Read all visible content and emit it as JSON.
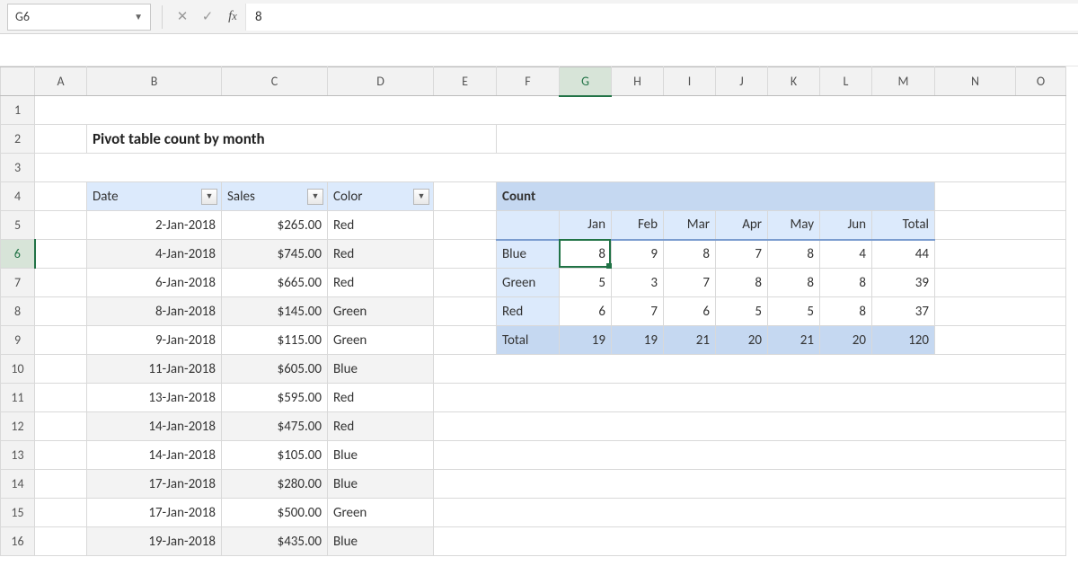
{
  "formula_bar": {
    "cell_ref": "G6",
    "value": "8"
  },
  "title": "Pivot table count by month",
  "columns": [
    "A",
    "B",
    "C",
    "D",
    "E",
    "F",
    "G",
    "H",
    "I",
    "J",
    "K",
    "L",
    "M",
    "N",
    "O"
  ],
  "rows": [
    "1",
    "2",
    "3",
    "4",
    "5",
    "6",
    "7",
    "8",
    "9",
    "10",
    "11",
    "12",
    "13",
    "14",
    "15",
    "16"
  ],
  "active_col": "G",
  "active_row": "6",
  "source": {
    "headers": {
      "date": "Date",
      "sales": "Sales",
      "color": "Color"
    },
    "rows": [
      {
        "date": "2-Jan-2018",
        "sales": "$265.00",
        "color": "Red"
      },
      {
        "date": "4-Jan-2018",
        "sales": "$745.00",
        "color": "Red"
      },
      {
        "date": "6-Jan-2018",
        "sales": "$665.00",
        "color": "Red"
      },
      {
        "date": "8-Jan-2018",
        "sales": "$145.00",
        "color": "Green"
      },
      {
        "date": "9-Jan-2018",
        "sales": "$115.00",
        "color": "Green"
      },
      {
        "date": "11-Jan-2018",
        "sales": "$605.00",
        "color": "Blue"
      },
      {
        "date": "13-Jan-2018",
        "sales": "$595.00",
        "color": "Red"
      },
      {
        "date": "14-Jan-2018",
        "sales": "$475.00",
        "color": "Red"
      },
      {
        "date": "14-Jan-2018",
        "sales": "$105.00",
        "color": "Blue"
      },
      {
        "date": "17-Jan-2018",
        "sales": "$280.00",
        "color": "Blue"
      },
      {
        "date": "17-Jan-2018",
        "sales": "$500.00",
        "color": "Green"
      },
      {
        "date": "19-Jan-2018",
        "sales": "$435.00",
        "color": "Blue"
      }
    ]
  },
  "pivot": {
    "title": "Count",
    "col_headers": [
      "Jan",
      "Feb",
      "Mar",
      "Apr",
      "May",
      "Jun",
      "Total"
    ],
    "rows": [
      {
        "label": "Blue",
        "vals": [
          "8",
          "9",
          "8",
          "7",
          "8",
          "4",
          "44"
        ]
      },
      {
        "label": "Green",
        "vals": [
          "5",
          "3",
          "7",
          "8",
          "8",
          "8",
          "39"
        ]
      },
      {
        "label": "Red",
        "vals": [
          "6",
          "7",
          "6",
          "5",
          "5",
          "8",
          "37"
        ]
      }
    ],
    "total": {
      "label": "Total",
      "vals": [
        "19",
        "19",
        "21",
        "20",
        "21",
        "20",
        "120"
      ]
    }
  },
  "chart_data": {
    "type": "table",
    "title": "Count",
    "categories": [
      "Jan",
      "Feb",
      "Mar",
      "Apr",
      "May",
      "Jun"
    ],
    "series": [
      {
        "name": "Blue",
        "values": [
          8,
          9,
          8,
          7,
          8,
          4
        ]
      },
      {
        "name": "Green",
        "values": [
          5,
          3,
          7,
          8,
          8,
          8
        ]
      },
      {
        "name": "Red",
        "values": [
          6,
          7,
          6,
          5,
          5,
          8
        ]
      }
    ],
    "totals_by_month": [
      19,
      19,
      21,
      20,
      21,
      20
    ],
    "grand_total": 120
  }
}
